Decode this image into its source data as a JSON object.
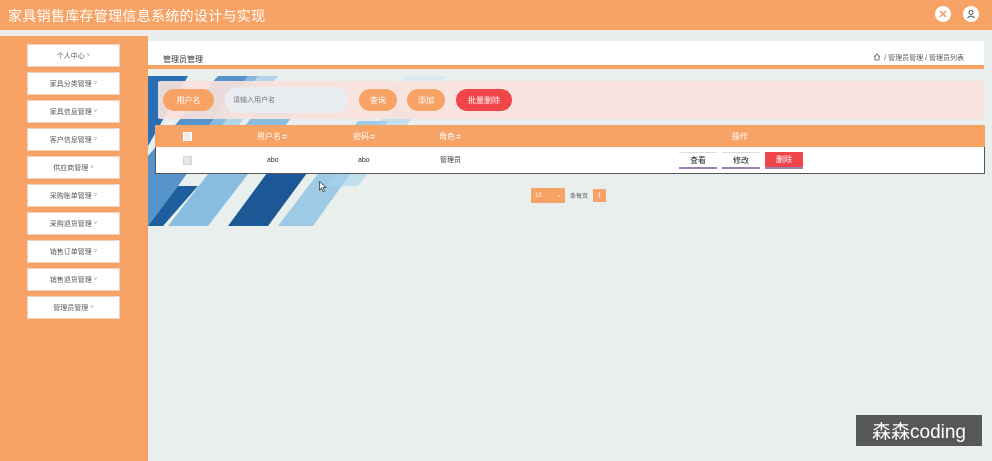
{
  "app": {
    "title": "家具销售库存管理信息系统的设计与实现",
    "icons": [
      "close-x-icon",
      "user-icon"
    ]
  },
  "sidebar": {
    "items": [
      {
        "label": "个人中心"
      },
      {
        "label": "家具分类管理"
      },
      {
        "label": "家具信息管理"
      },
      {
        "label": "客户信息管理"
      },
      {
        "label": "供应商管理"
      },
      {
        "label": "采购账单管理"
      },
      {
        "label": "采购退货管理"
      },
      {
        "label": "销售订单管理"
      },
      {
        "label": "销售退货管理"
      },
      {
        "label": "管理员管理"
      }
    ],
    "chevron": "˅"
  },
  "header": {
    "title": "管理员管理",
    "breadcrumb": [
      "管理员管理",
      "管理员列表"
    ],
    "breadcrumb_sep": "/"
  },
  "search": {
    "label": "用户名",
    "placeholder": "请输入用户名",
    "query_label": "查询",
    "add_label": "添加",
    "batch_delete_label": "批量删除"
  },
  "table": {
    "columns": [
      "用户名",
      "密码",
      "角色",
      "操作"
    ],
    "sort_mark": "≑",
    "rows": [
      {
        "username": "abo",
        "password": "abo",
        "role": "管理员"
      }
    ],
    "actions": {
      "view": "查看",
      "edit": "修改",
      "delete": "删除"
    }
  },
  "pager": {
    "page_size": "10",
    "total_text": "条每页",
    "current_page": "1"
  },
  "watermark": "森森coding",
  "colors": {
    "accent": "#f7a366",
    "danger": "#f0464a",
    "content_bg": "#e8efec"
  }
}
